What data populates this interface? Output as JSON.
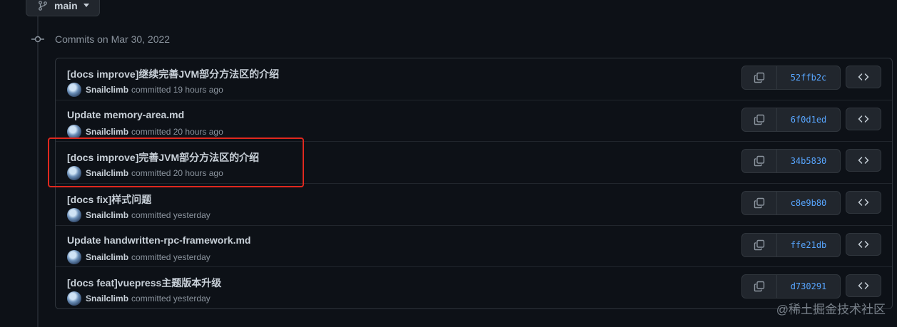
{
  "branch": {
    "label": "main",
    "icon": "git-branch-icon"
  },
  "group": {
    "title": "Commits on Mar 30, 2022",
    "icon": "git-commit-icon"
  },
  "commits": [
    {
      "message": "[docs improve]继续完善JVM部分方法区的介绍",
      "author": "Snailclimb",
      "time": "committed 19 hours ago",
      "sha": "52ffb2c"
    },
    {
      "message": "Update memory-area.md",
      "author": "Snailclimb",
      "time": "committed 20 hours ago",
      "sha": "6f0d1ed"
    },
    {
      "message": "[docs improve]完善JVM部分方法区的介绍",
      "author": "Snailclimb",
      "time": "committed 20 hours ago",
      "sha": "34b5830"
    },
    {
      "message": "[docs fix]样式问题",
      "author": "Snailclimb",
      "time": "committed yesterday",
      "sha": "c8e9b80"
    },
    {
      "message": "Update handwritten-rpc-framework.md",
      "author": "Snailclimb",
      "time": "committed yesterday",
      "sha": "ffe21db"
    },
    {
      "message": "[docs feat]vuepress主题版本升级",
      "author": "Snailclimb",
      "time": "committed yesterday",
      "sha": "d730291"
    }
  ],
  "watermark": "@稀土掘金技术社区",
  "colors": {
    "highlight": "#e0281e",
    "link": "#58a6ff",
    "background": "#0d1117"
  }
}
